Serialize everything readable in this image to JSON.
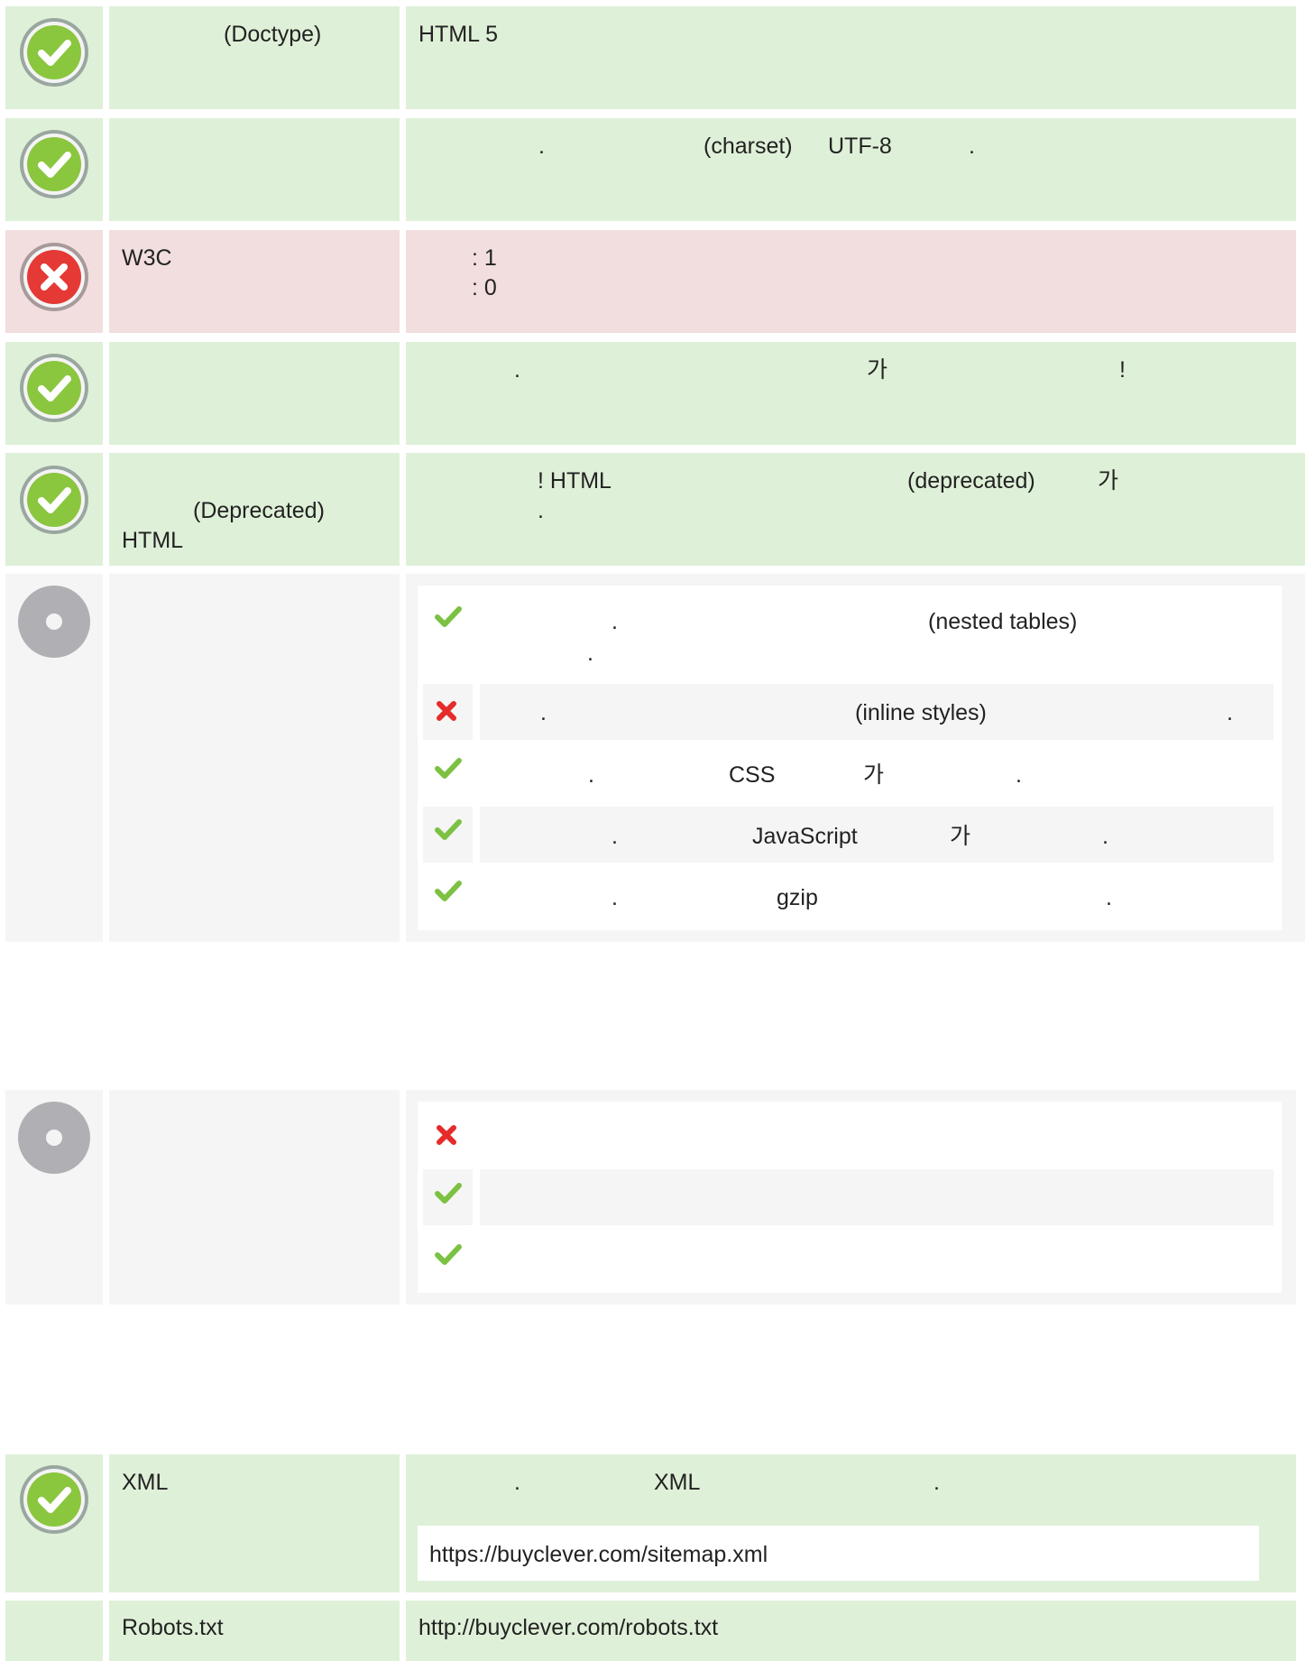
{
  "colors": {
    "pass_bg": "#dff0d8",
    "fail_bg": "#f2dede",
    "info_bg": "#f5f5f5",
    "pass_icon": "#8bc63f",
    "fail_icon": "#e53935",
    "info_icon": "#b0b0b4",
    "mini_check": "#7cc142",
    "mini_cross": "#e52b2b"
  },
  "checks": [
    {
      "status": "pass",
      "label": "(Doctype)",
      "value": "HTML 5"
    },
    {
      "status": "pass",
      "label": "",
      "value_parts": [
        ".",
        "(charset)",
        "UTF-8",
        "."
      ]
    },
    {
      "status": "fail",
      "label": "W3C",
      "value_lines": [
        ": 1",
        ": 0"
      ]
    },
    {
      "status": "pass",
      "label": "",
      "value_parts": [
        ".",
        "가",
        "!"
      ]
    },
    {
      "status": "pass",
      "label_lines": [
        "(Deprecated)",
        "HTML"
      ],
      "value_parts": [
        "! HTML",
        "(deprecated)",
        "가",
        "."
      ]
    }
  ],
  "optimization": {
    "status": "info",
    "items": [
      {
        "ok": true,
        "parts": [
          ".",
          "(nested tables)",
          "."
        ]
      },
      {
        "ok": false,
        "parts": [
          ".",
          "(inline styles)",
          "."
        ]
      },
      {
        "ok": true,
        "parts": [
          ".",
          "CSS",
          "가",
          "."
        ]
      },
      {
        "ok": true,
        "parts": [
          ".",
          "JavaScript",
          "가",
          "."
        ]
      },
      {
        "ok": true,
        "parts": [
          ".",
          "gzip",
          "."
        ]
      }
    ]
  },
  "second_block": {
    "status": "info",
    "items": [
      {
        "ok": false
      },
      {
        "ok": true
      },
      {
        "ok": true
      }
    ]
  },
  "sitemap": {
    "status": "pass",
    "label": "XML",
    "parts": [
      ".",
      "XML",
      "."
    ],
    "url": "https://buyclever.com/sitemap.xml"
  },
  "robots": {
    "label": "Robots.txt",
    "url": "http://buyclever.com/robots.txt"
  }
}
